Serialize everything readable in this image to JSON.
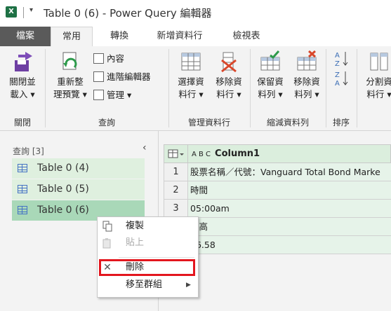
{
  "window": {
    "title": "Table 0 (6) - Power Query 編輯器",
    "app_icon": "X"
  },
  "tabs": [
    "檔案",
    "常用",
    "轉換",
    "新增資料行",
    "檢視表"
  ],
  "ribbon": {
    "close_group": {
      "label": "關閉",
      "close_load": [
        "關閉並",
        "載入 ▾"
      ]
    },
    "query_group": {
      "label": "查詢",
      "refresh": [
        "重新整",
        "理預覽 ▾"
      ],
      "properties": "內容",
      "advanced_editor": "進階編輯器",
      "manage": "管理 ▾"
    },
    "manage_columns_group": {
      "label": "管理資料行",
      "choose_columns": [
        "選擇資",
        "料行 ▾"
      ],
      "remove_columns": [
        "移除資",
        "料行 ▾"
      ]
    },
    "reduce_rows_group": {
      "label": "縮減資料列",
      "keep_rows": [
        "保留資",
        "料列 ▾"
      ],
      "remove_rows": [
        "移除資",
        "料列 ▾"
      ]
    },
    "sort_group": {
      "label": "排序"
    },
    "split_group": {
      "split_column": [
        "分割資",
        "料行 ▾"
      ]
    }
  },
  "queries": {
    "header": "查詢 [3]",
    "items": [
      "Table 0 (4)",
      "Table 0 (5)",
      "Table 0 (6)"
    ]
  },
  "grid": {
    "type_glyph": "A B C",
    "column_header": "Column1",
    "rows": [
      {
        "num": "1",
        "value": "股票名稱／代號：Vanguard Total Bond Marke"
      },
      {
        "num": "2",
        "value": "時間"
      },
      {
        "num": "3",
        "value": "05:00am"
      },
      {
        "num": "4",
        "value": "最高"
      },
      {
        "num": "5",
        "value": "76.58"
      }
    ]
  },
  "context_menu": {
    "copy": "複製",
    "paste": "貼上",
    "delete": "刪除",
    "move_to_group": "移至群組"
  },
  "colors": {
    "accent": "#217346",
    "highlight_box": "#e3161e",
    "selected_query": "#a9d8b8"
  }
}
